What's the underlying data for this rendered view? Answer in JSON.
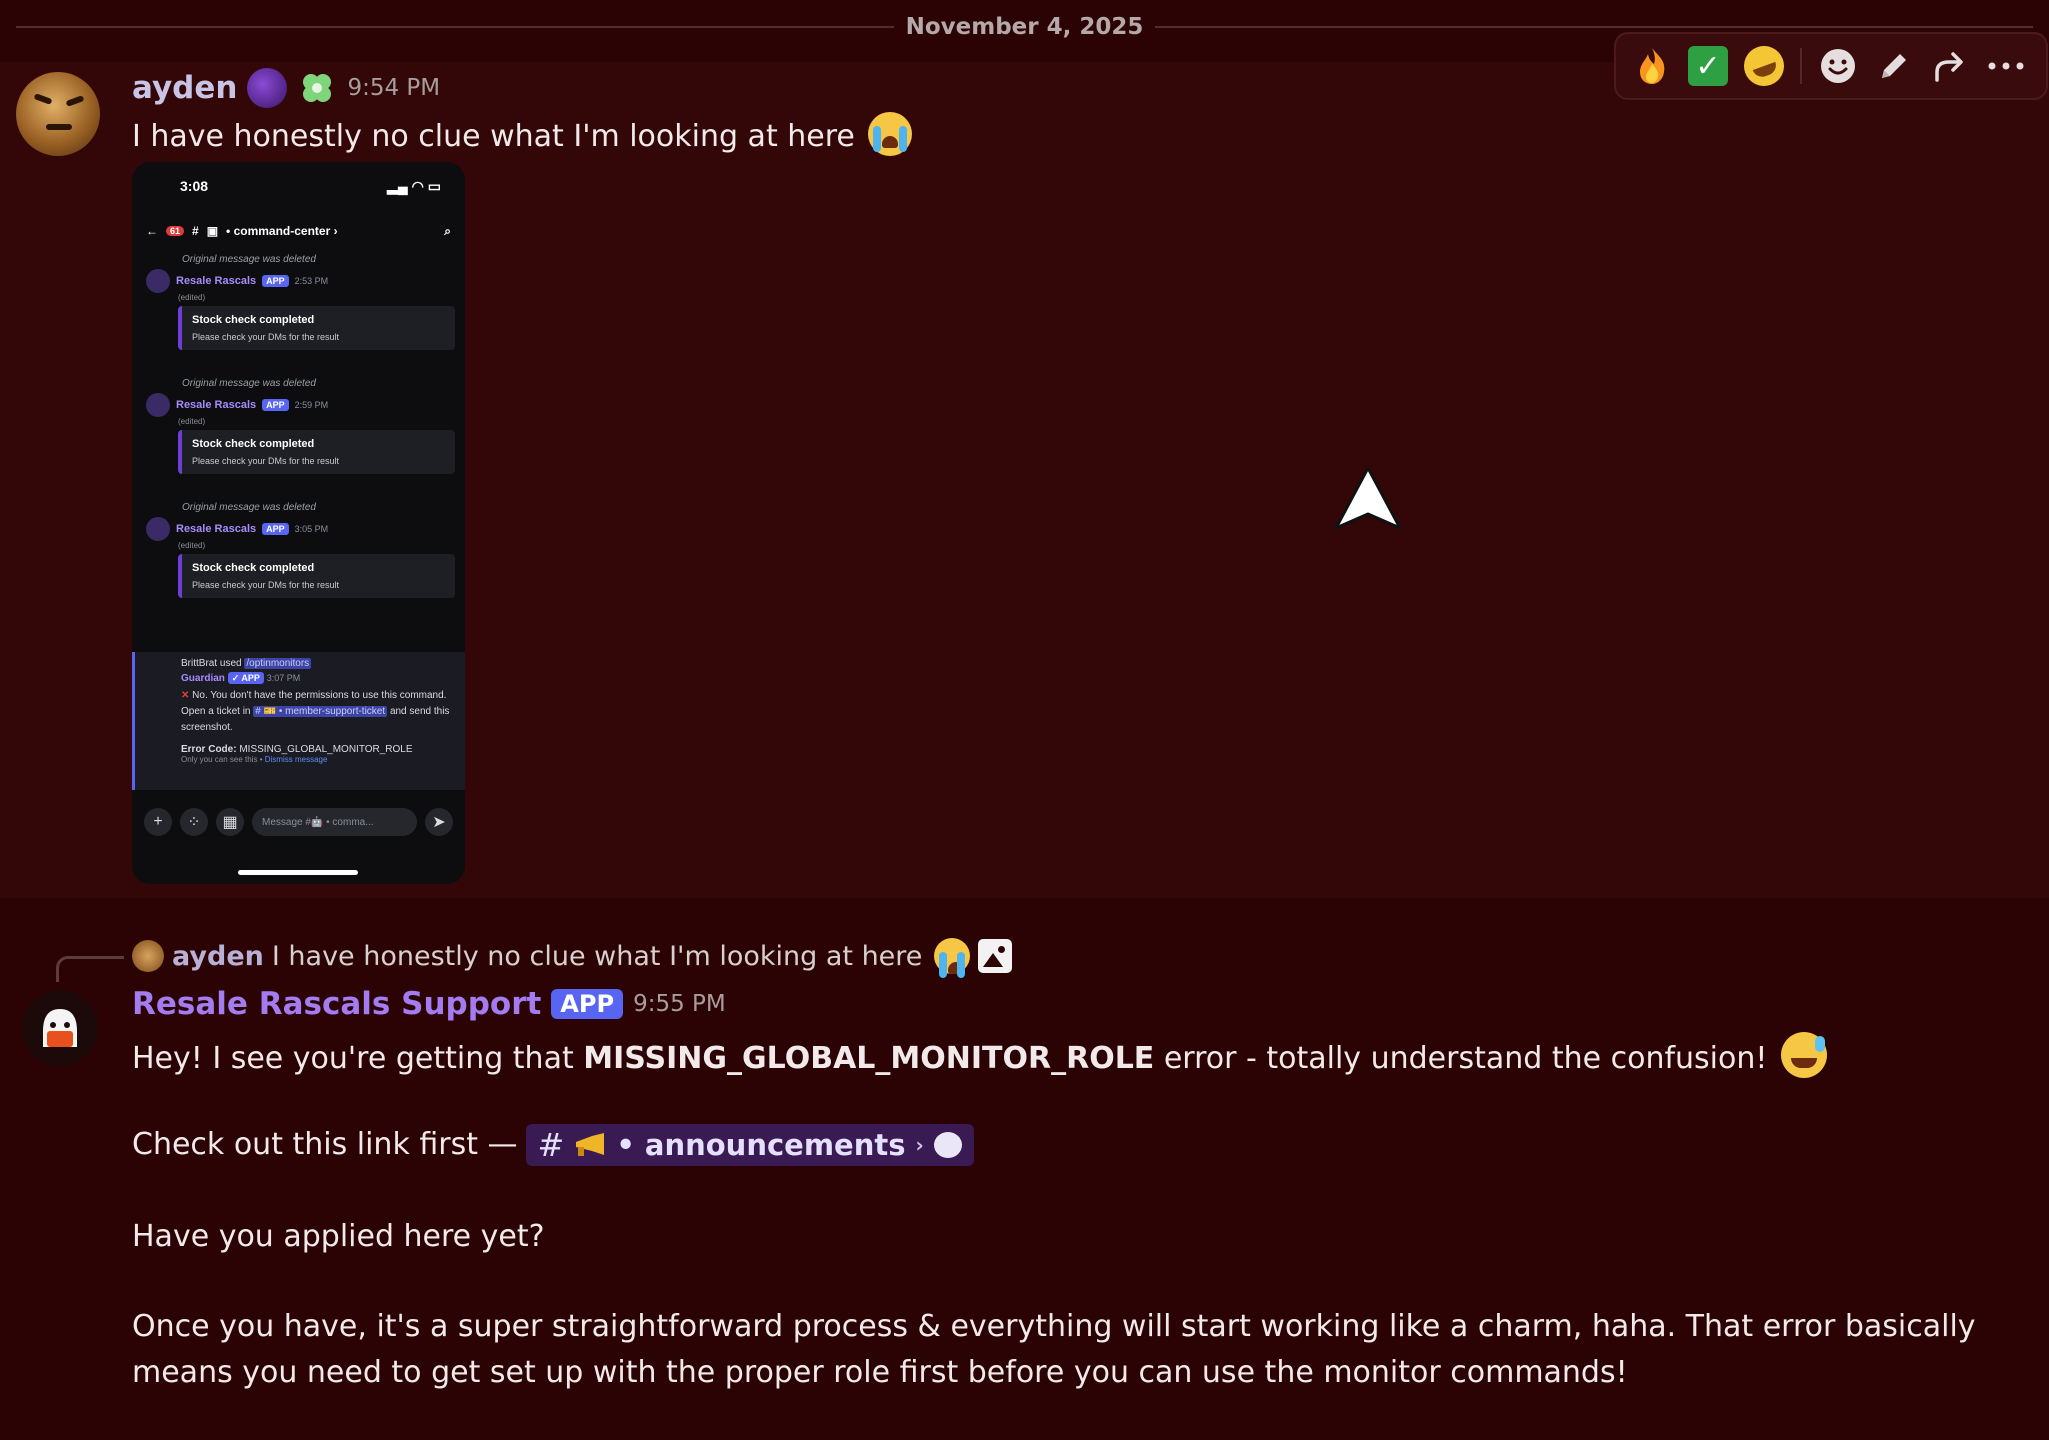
{
  "divider": {
    "date": "November 4, 2025"
  },
  "toolbar": {
    "reactions": [
      "fire-emoji",
      "check-mark-emoji",
      "rofl-emoji"
    ],
    "actions": [
      "add-reaction",
      "edit",
      "reply",
      "more"
    ]
  },
  "message1": {
    "author": "ayden",
    "time": "9:54 PM",
    "text": "I have honestly no clue what I'm looking at here"
  },
  "phone": {
    "clock": "3:08",
    "channel": "• command-center ›",
    "unread_badge": "61",
    "items": [
      {
        "deleted": "Original message was deleted",
        "author": "Resale Rascals",
        "app": "APP",
        "time": "2:53 PM",
        "edited": "(edited)",
        "embed_title": "Stock check completed",
        "embed_body": "Please check your DMs for the result"
      },
      {
        "deleted": "Original message was deleted",
        "author": "Resale Rascals",
        "app": "APP",
        "time": "2:59 PM",
        "edited": "(edited)",
        "embed_title": "Stock check completed",
        "embed_body": "Please check your DMs for the result"
      },
      {
        "deleted": "Original message was deleted",
        "author": "Resale Rascals",
        "app": "APP",
        "time": "3:05 PM",
        "edited": "(edited)",
        "embed_title": "Stock check completed",
        "embed_body": "Please check your DMs for the result"
      }
    ],
    "ephemeral": {
      "user_used": "BrittBrat used",
      "command": "/optinmonitors",
      "bot": "Guardian",
      "bot_app": "✓ APP",
      "bot_time": "3:07 PM",
      "line1": "No. You don't have the permissions to use this command. Open a ticket in",
      "channel": "# 🎫 • member-support-ticket",
      "line2": "and send this screenshot.",
      "error_label": "Error Code:",
      "error_code": "MISSING_GLOBAL_MONITOR_ROLE",
      "only_you": "Only you can see this •",
      "dismiss": "Dismiss message"
    },
    "composer_placeholder": "Message #🤖 • comma..."
  },
  "reply": {
    "author": "ayden",
    "text": "I have honestly no clue what I'm looking at here"
  },
  "message2": {
    "author": "Resale Rascals Support",
    "badge": "APP",
    "time": "9:55 PM",
    "p1_before": "Hey! I see you're getting that ",
    "p1_bold": "MISSING_GLOBAL_MONITOR_ROLE",
    "p1_after": " error - totally understand the confusion!",
    "p2_prefix": "Check out this link first —",
    "p2_channel": "announcements",
    "p2_channel_prefix": "•",
    "p3": "Have you applied here yet?",
    "p4": "Once you have, it's a super straightforward process & everything will start working like a charm, haha. That error basically means you need to get set up with the proper role first before you can use the monitor commands!"
  },
  "colors": {
    "background": "#2b0304",
    "hover_background": "#330708",
    "bot_name": "#a27cf0",
    "app_badge": "#5865f2",
    "channel_pill": "#3a1a52"
  }
}
